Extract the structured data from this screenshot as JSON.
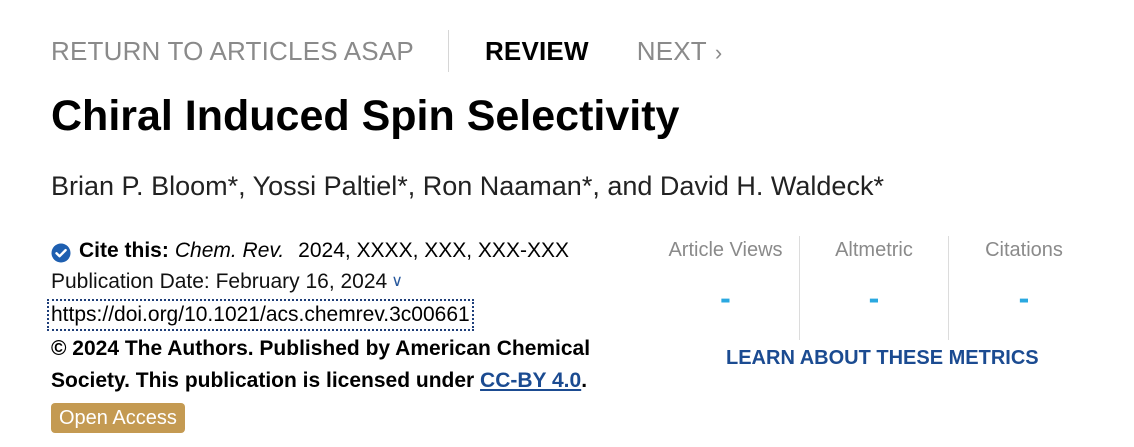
{
  "nav": {
    "return_label": "RETURN TO ARTICLES ASAP",
    "review_label": "REVIEW",
    "next_label": "NEXT",
    "next_icon": "chevron-right-icon"
  },
  "article": {
    "title": "Chiral Induced Spin Selectivity",
    "authors": [
      "Brian P. Bloom*",
      "Yossi Paltiel*",
      "Ron Naaman*",
      "David H. Waldeck*"
    ],
    "author_sep_1": ", ",
    "author_sep_2": ", ",
    "author_sep_3": ", and ",
    "cite_label": "Cite this:",
    "cite_journal": "Chem. Rev.",
    "cite_details": "2024, XXXX, XXX, XXX-XXX",
    "pub_date": "Publication Date: February 16, 2024",
    "doi": "https://doi.org/10.1021/acs.chemrev.3c00661",
    "license_text": "© 2024 The Authors. Published by American Chemical Society. This publication is licensed under ",
    "license_link": "CC-BY 4.0",
    "license_end": ".",
    "open_access": "Open Access"
  },
  "metrics": {
    "items": [
      {
        "label": "Article Views",
        "value": "-"
      },
      {
        "label": "Altmetric",
        "value": "-"
      },
      {
        "label": "Citations",
        "value": "-"
      }
    ],
    "learn_link": "LEARN ABOUT THESE METRICS"
  },
  "colors": {
    "accent_blue": "#2aa8e0",
    "link_blue": "#1b4b91",
    "open_access_bg": "#c49a52",
    "muted_gray": "#8a8a8a"
  }
}
